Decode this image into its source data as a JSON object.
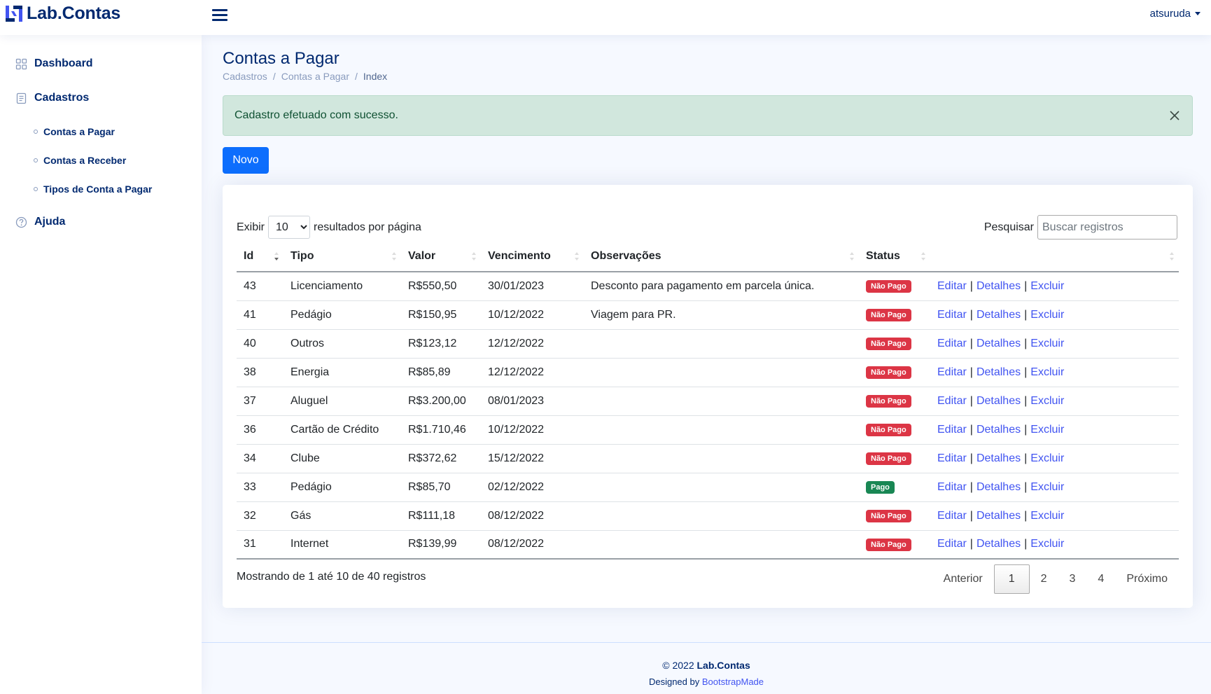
{
  "header": {
    "app_name": "Lab.Contas",
    "user": "atsuruda"
  },
  "sidebar": {
    "items": [
      {
        "label": "Dashboard",
        "icon": "grid-icon"
      },
      {
        "label": "Cadastros",
        "icon": "journal-icon"
      },
      {
        "label": "Ajuda",
        "icon": "question-circle-icon"
      }
    ],
    "sub_items": [
      {
        "label": "Contas a Pagar"
      },
      {
        "label": "Contas a Receber"
      },
      {
        "label": "Tipos de Conta a Pagar"
      }
    ]
  },
  "page": {
    "title": "Contas a Pagar",
    "breadcrumb": [
      "Cadastros",
      "Contas a Pagar",
      "Index"
    ]
  },
  "alert": {
    "message": "Cadastro efetuado com sucesso."
  },
  "toolbar": {
    "new_label": "Novo"
  },
  "table_controls": {
    "show_prefix": "Exibir",
    "page_size": "10",
    "show_suffix": "resultados por página",
    "search_label": "Pesquisar",
    "search_placeholder": "Buscar registros"
  },
  "table": {
    "columns": [
      "Id",
      "Tipo",
      "Valor",
      "Vencimento",
      "Observações",
      "Status",
      ""
    ],
    "action_labels": {
      "edit": "Editar",
      "details": "Detalhes",
      "delete": "Excluir",
      "separator": "|"
    },
    "rows": [
      {
        "id": "43",
        "tipo": "Licenciamento",
        "valor": "R$550,50",
        "vencimento": "30/01/2023",
        "obs": "Desconto para pagamento em parcela única.",
        "status": "Não Pago",
        "paid": false
      },
      {
        "id": "41",
        "tipo": "Pedágio",
        "valor": "R$150,95",
        "vencimento": "10/12/2022",
        "obs": "Viagem para PR.",
        "status": "Não Pago",
        "paid": false
      },
      {
        "id": "40",
        "tipo": "Outros",
        "valor": "R$123,12",
        "vencimento": "12/12/2022",
        "obs": "",
        "status": "Não Pago",
        "paid": false
      },
      {
        "id": "38",
        "tipo": "Energia",
        "valor": "R$85,89",
        "vencimento": "12/12/2022",
        "obs": "",
        "status": "Não Pago",
        "paid": false
      },
      {
        "id": "37",
        "tipo": "Aluguel",
        "valor": "R$3.200,00",
        "vencimento": "08/01/2023",
        "obs": "",
        "status": "Não Pago",
        "paid": false
      },
      {
        "id": "36",
        "tipo": "Cartão de Crédito",
        "valor": "R$1.710,46",
        "vencimento": "10/12/2022",
        "obs": "",
        "status": "Não Pago",
        "paid": false
      },
      {
        "id": "34",
        "tipo": "Clube",
        "valor": "R$372,62",
        "vencimento": "15/12/2022",
        "obs": "",
        "status": "Não Pago",
        "paid": false
      },
      {
        "id": "33",
        "tipo": "Pedágio",
        "valor": "R$85,70",
        "vencimento": "02/12/2022",
        "obs": "",
        "status": "Pago",
        "paid": true
      },
      {
        "id": "32",
        "tipo": "Gás",
        "valor": "R$111,18",
        "vencimento": "08/12/2022",
        "obs": "",
        "status": "Não Pago",
        "paid": false
      },
      {
        "id": "31",
        "tipo": "Internet",
        "valor": "R$139,99",
        "vencimento": "08/12/2022",
        "obs": "",
        "status": "Não Pago",
        "paid": false
      }
    ]
  },
  "pagination": {
    "info": "Mostrando de 1 até 10 de 40 registros",
    "previous": "Anterior",
    "pages": [
      "1",
      "2",
      "3",
      "4"
    ],
    "current": "1",
    "next": "Próximo"
  },
  "footer": {
    "copyright_prefix": "© 2022",
    "brand": "Lab.Contas",
    "designed_by": "Designed by",
    "designer": "BootstrapMade"
  },
  "colors": {
    "brand": "#012970",
    "primary": "#0d6efd",
    "link": "#4154f1",
    "danger": "#dc3545",
    "success": "#198754",
    "alert_bg": "#d1e7dd"
  }
}
